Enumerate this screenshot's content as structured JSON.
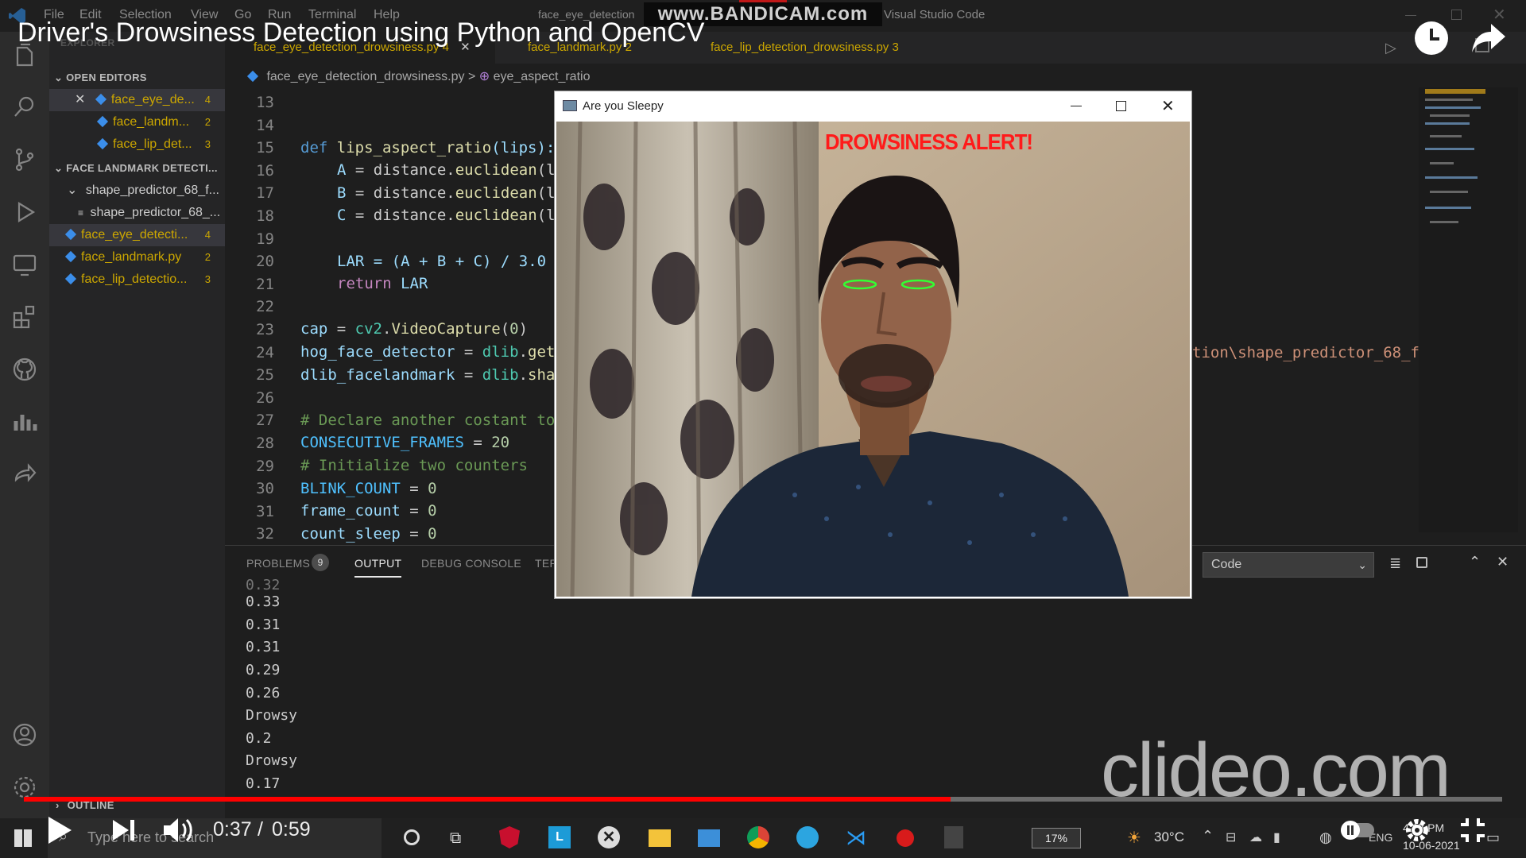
{
  "video": {
    "title": "Driver's Drowsiness Detection using Python and OpenCV",
    "time_current": "0:37",
    "time_separator": "/",
    "time_total": "0:59",
    "progress": 0.627,
    "watermark": "clideo.com"
  },
  "recorder_watermark": "www.BANDICAM.com",
  "vscode": {
    "menu": [
      "File",
      "Edit",
      "Selection",
      "View",
      "Go",
      "Run",
      "Terminal",
      "Help"
    ],
    "window_title": "face_eye_detection",
    "app_name": "Visual Studio Code",
    "explorer_label": "EXPLORER",
    "sidebar": {
      "open_editors_header": "OPEN EDITORS",
      "open_editors": [
        {
          "name": "face_eye_de...",
          "badge": "4"
        },
        {
          "name": "face_landm...",
          "badge": "2"
        },
        {
          "name": "face_lip_det...",
          "badge": "3"
        }
      ],
      "project_header": "FACE LANDMARK DETECTI...",
      "folder": "shape_predictor_68_f...",
      "folder_file": "shape_predictor_68_...",
      "files": [
        {
          "name": "face_eye_detecti...",
          "badge": "4"
        },
        {
          "name": "face_landmark.py",
          "badge": "2"
        },
        {
          "name": "face_lip_detectio...",
          "badge": "3"
        }
      ],
      "outline_header": "OUTLINE"
    },
    "tabs": [
      {
        "label": "face_eye_detection_drowsiness.py",
        "badge": "4"
      },
      {
        "label": "face_landmark.py",
        "badge": "2"
      },
      {
        "label": "face_lip_detection_drowsiness.py",
        "badge": "3"
      }
    ],
    "breadcrumb": {
      "file": "face_eye_detection_drowsiness.py",
      "sep": ">",
      "symbol": "eye_aspect_ratio"
    },
    "right_code_fragment": "tion\\shape_predictor_68_f",
    "panel": {
      "tabs": [
        "PROBLEMS",
        "OUTPUT",
        "DEBUG CONSOLE",
        "TER"
      ],
      "problems_count": "9",
      "channel": "Code",
      "output_lines": [
        "0.32",
        "0.33",
        "0.31",
        "0.31",
        "0.29",
        "0.26",
        "Drowsy",
        "0.2",
        "Drowsy",
        "0.17"
      ]
    }
  },
  "code": {
    "line_numbers": [
      "13",
      "14",
      "15",
      "16",
      "17",
      "18",
      "19",
      "20",
      "21",
      "22",
      "23",
      "24",
      "25",
      "26",
      "27",
      "28",
      "29",
      "30",
      "31",
      "32"
    ],
    "l14": {
      "kw": "def",
      "fn": "lips_aspect_ratio",
      "rest": "(lips):"
    },
    "l15": {
      "var": "A",
      "rest": " = distance.",
      "fn": "euclidean",
      "tail": "(l"
    },
    "l16": {
      "var": "B",
      "rest": " = distance.",
      "fn": "euclidean",
      "tail": "(l"
    },
    "l17": {
      "var": "C",
      "rest": " = distance.",
      "fn": "euclidean",
      "tail": "(l"
    },
    "l19": {
      "text": "LAR = (A + B + C) / 3.0"
    },
    "l20": {
      "kw": "return",
      "var": "LAR"
    },
    "l22": {
      "var": "cap",
      "mid": " = ",
      "mod": "cv2",
      "dot": ".",
      "fn": "VideoCapture",
      "arg": "(",
      "num": "0",
      "end": ")"
    },
    "l23": {
      "var": "hog_face_detector",
      "mid": " = ",
      "mod": "dlib",
      "dot": ".",
      "fn": "get"
    },
    "l24": {
      "var": "dlib_facelandmark",
      "mid": " = ",
      "mod": "dlib",
      "dot": ".",
      "fn": "sha"
    },
    "l26": {
      "comment": "# Declare another costant to"
    },
    "l27": {
      "cst": "CONSECUTIVE_FRAMES",
      "mid": " = ",
      "num": "20"
    },
    "l28": {
      "comment": "# Initialize two counters"
    },
    "l29": {
      "cst": "BLINK_COUNT",
      "mid": " = ",
      "num": "0"
    },
    "l30": {
      "var": "frame_count",
      "mid": " = ",
      "num": "0"
    },
    "l31": {
      "var": "count_sleep",
      "mid": " = ",
      "num": "0"
    }
  },
  "cv_window": {
    "title": "Are you Sleepy",
    "alert_text": "DROWSINESS ALERT!"
  },
  "taskbar": {
    "search_placeholder": "Type here to search",
    "battery": "17%",
    "temperature": "30°C",
    "language": "ENG",
    "time": "4:37 PM",
    "date": "10-06-2021"
  },
  "colors": {
    "progress": "#ff0000",
    "alert": "#ff1a1a",
    "eye_contour": "#33ff33",
    "vscode_blue": "#007acc"
  }
}
